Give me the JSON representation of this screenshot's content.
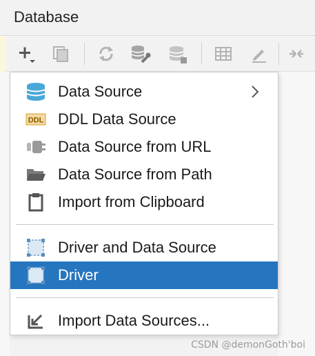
{
  "panel": {
    "title": "Database"
  },
  "toolbar": {
    "buttons": [
      "add-icon",
      "duplicate-icon",
      "refresh-icon",
      "data-source-properties-icon",
      "db-disconnect-icon",
      "table-icon",
      "edit-icon",
      "collapse-icon"
    ]
  },
  "menu": {
    "items": [
      {
        "label": "Data Source",
        "icon": "database-icon",
        "submenu": true
      },
      {
        "label": "DDL Data Source",
        "icon": "ddl-icon",
        "badge": "DDL"
      },
      {
        "label": "Data Source from URL",
        "icon": "url-plug-icon"
      },
      {
        "label": "Data Source from Path",
        "icon": "folder-icon"
      },
      {
        "label": "Import from Clipboard",
        "icon": "clipboard-icon"
      },
      {
        "label": "Driver and Data Source",
        "icon": "driver-icon"
      },
      {
        "label": "Driver",
        "icon": "driver-icon",
        "selected": true
      },
      {
        "label": "Import Data Sources...",
        "icon": "import-icon"
      }
    ]
  },
  "colors": {
    "selection": "#2675bf",
    "db_icon": "#4aa8d8"
  },
  "watermark": "CSDN @demonGoth'boi"
}
